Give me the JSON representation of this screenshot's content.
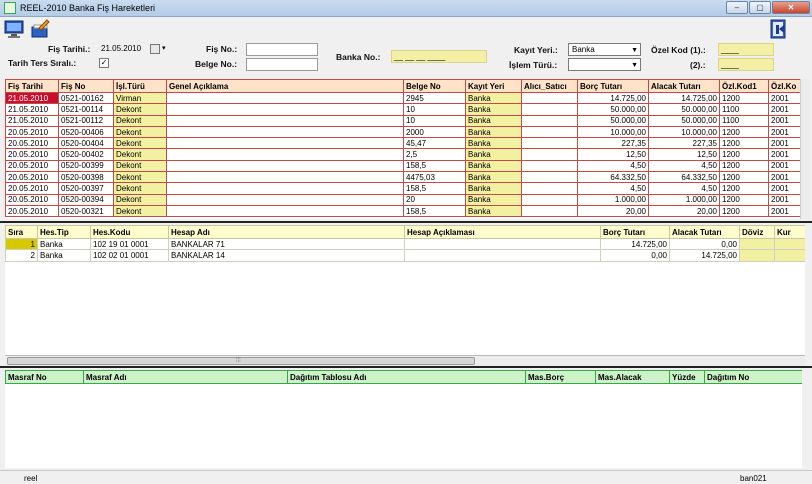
{
  "window": {
    "title": "REEL-2010 Banka Fiş Hareketleri",
    "minimize": "–",
    "maximize": "▢",
    "close": "✕"
  },
  "filters": {
    "fis_tarihi_label": "Fiş Tarihi.:",
    "fis_tarihi_value": "21.05.2010",
    "tarih_ters_label": "Tarih Ters Sıralı.:",
    "tarih_ters_checked": "✓",
    "fis_no_label": "Fiş No.:",
    "fis_no_value": "",
    "belge_no_label": "Belge No.:",
    "belge_no_value": "",
    "banka_no_label": "Banka No.:",
    "banka_no_value": "__ __ __ ____",
    "kayit_yeri_label": "Kayıt Yeri.:",
    "kayit_yeri_value": "Banka",
    "islem_turu_label": "İşlem Türü.:",
    "islem_turu_value": "",
    "ozel_kod1_label": "Özel Kod (1).:",
    "ozel_kod1_value": "____",
    "ozel_kod2_label": "(2).:",
    "ozel_kod2_value": "____"
  },
  "main_grid": {
    "columns": [
      "Fiş Tarihi",
      "Fiş No",
      "İşl.Türü",
      "Genel Açıklama",
      "Belge No",
      "Kayıt Yeri",
      "Alıcı_Satıcı",
      "Borç Tutarı",
      "Alacak Tutarı",
      "Özl.Kod1",
      "Özl.Ko"
    ],
    "rows": [
      [
        "21.05.2010",
        "0521-00162",
        "Virman",
        "",
        "2945",
        "Banka",
        "",
        "14.725,00",
        "14.725,00",
        "1200",
        "2001"
      ],
      [
        "21.05.2010",
        "0521-00114",
        "Dekont",
        "",
        "10",
        "Banka",
        "",
        "50.000,00",
        "50.000,00",
        "1100",
        "2001"
      ],
      [
        "21.05.2010",
        "0521-00112",
        "Dekont",
        "",
        "10",
        "Banka",
        "",
        "50.000,00",
        "50.000,00",
        "1100",
        "2001"
      ],
      [
        "20.05.2010",
        "0520-00406",
        "Dekont",
        "",
        "2000",
        "Banka",
        "",
        "10.000,00",
        "10.000,00",
        "1200",
        "2001"
      ],
      [
        "20.05.2010",
        "0520-00404",
        "Dekont",
        "",
        "45,47",
        "Banka",
        "",
        "227,35",
        "227,35",
        "1200",
        "2001"
      ],
      [
        "20.05.2010",
        "0520-00402",
        "Dekont",
        "",
        "2,5",
        "Banka",
        "",
        "12,50",
        "12,50",
        "1200",
        "2001"
      ],
      [
        "20.05.2010",
        "0520-00399",
        "Dekont",
        "",
        "158,5",
        "Banka",
        "",
        "4,50",
        "4,50",
        "1200",
        "2001"
      ],
      [
        "20.05.2010",
        "0520-00398",
        "Dekont",
        "",
        "4475,03",
        "Banka",
        "",
        "64.332,50",
        "64.332,50",
        "1200",
        "2001"
      ],
      [
        "20.05.2010",
        "0520-00397",
        "Dekont",
        "",
        "158,5",
        "Banka",
        "",
        "4,50",
        "4,50",
        "1200",
        "2001"
      ],
      [
        "20.05.2010",
        "0520-00394",
        "Dekont",
        "",
        "20",
        "Banka",
        "",
        "1.000,00",
        "1.000,00",
        "1200",
        "2001"
      ],
      [
        "20.05.2010",
        "0520-00321",
        "Dekont",
        "",
        "158,5",
        "Banka",
        "",
        "20,00",
        "20,00",
        "1200",
        "2001"
      ]
    ]
  },
  "detail_grid": {
    "columns": [
      "Sıra",
      "Hes.Tip",
      "Hes.Kodu",
      "Hesap Adı",
      "Hesap Açıklaması",
      "Borç Tutarı",
      "Alacak Tutarı",
      "Döviz",
      "Kur"
    ],
    "rows": [
      [
        "1",
        "Banka",
        "102 19 01 0001",
        "BANKALAR 71",
        "",
        "14.725,00",
        "0,00",
        "",
        ""
      ],
      [
        "2",
        "Banka",
        "102 02 01 0001",
        "BANKALAR 14",
        "",
        "0,00",
        "14.725,00",
        "",
        ""
      ]
    ],
    "scroll_grip": "⦙⦙⦙"
  },
  "cost_grid": {
    "columns": [
      "Masraf No",
      "Masraf Adı",
      "Dağıtım Tablosu Adı",
      "Mas.Borç",
      "Mas.Alacak",
      "Yüzde",
      "Dağıtım No"
    ]
  },
  "status": {
    "left": "reel",
    "right": "ban021"
  }
}
